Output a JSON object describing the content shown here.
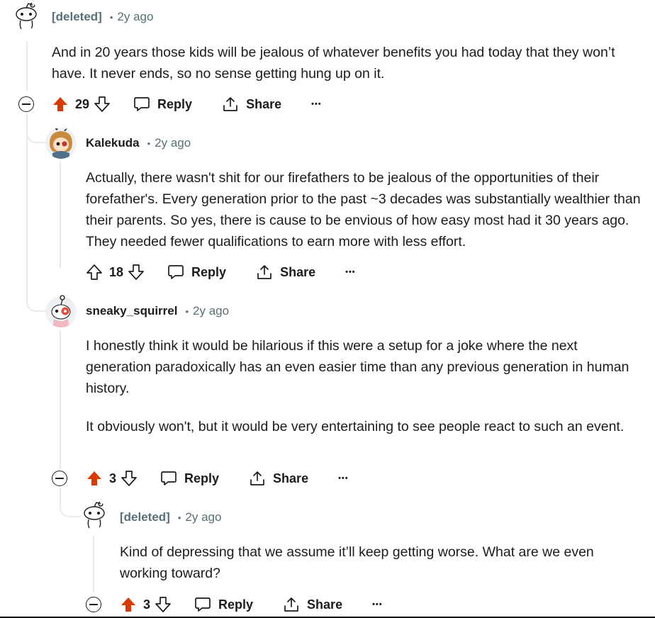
{
  "comments": [
    {
      "author": "[deleted]",
      "time": "2y ago",
      "body": [
        "And in 20 years those kids will be jealous of whatever benefits you had today that they won’t have. It never ends, so no sense getting hung up on it."
      ],
      "score": "29",
      "upvoted": true,
      "reply_label": "Reply",
      "share_label": "Share",
      "more_label": "•••"
    },
    {
      "author": "Kalekuda",
      "time": "2y ago",
      "body": [
        "Actually, there wasn't shit for our firefathers to be jealous of the opportunities of their forefather's. Every generation prior to the past ~3 decades was substantially wealthier than their parents. So yes, there is cause to be envious of how easy most had it 30 years ago. They needed fewer qualifications to earn more with less effort."
      ],
      "score": "18",
      "upvoted": false,
      "reply_label": "Reply",
      "share_label": "Share",
      "more_label": "•••"
    },
    {
      "author": "sneaky_squirrel",
      "time": "2y ago",
      "body": [
        "I honestly think it would be hilarious if this were a setup for a joke where the next generation paradoxically has an even easier time than any previous generation in human history.",
        "It obviously won't, but it would be very entertaining to see people react to such an event."
      ],
      "score": "3",
      "upvoted": true,
      "reply_label": "Reply",
      "share_label": "Share",
      "more_label": "•••"
    },
    {
      "author": "[deleted]",
      "time": "2y ago",
      "body": [
        "Kind of depressing that we assume it’ll keep getting worse. What are we even working toward?"
      ],
      "score": "3",
      "upvoted": true,
      "reply_label": "Reply",
      "share_label": "Share",
      "more_label": "•••"
    }
  ],
  "colors": {
    "upvote_active": "#d93a00",
    "meta_gray": "#576f76",
    "thread_line": "#e5ebee"
  },
  "icons": {
    "deleted_avatar": "snoo-outline-icon",
    "upvote": "arrow-up-icon",
    "downvote": "arrow-down-icon",
    "reply": "speech-bubble-icon",
    "share": "share-upload-icon",
    "collapse": "minus-circle-icon",
    "more": "ellipsis-icon"
  }
}
